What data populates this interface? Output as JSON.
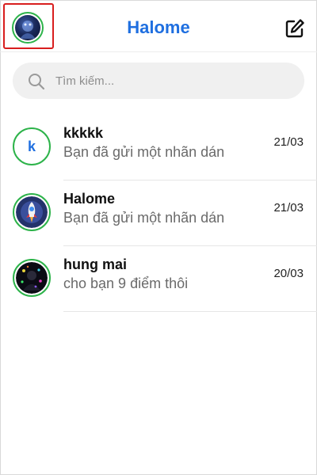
{
  "header": {
    "title": "Halome",
    "title_color": "#1f6fe0",
    "profile_icon": "profile-avatar-icon",
    "compose_icon": "compose-edit-icon",
    "highlight_color": "#d81e1e"
  },
  "search": {
    "placeholder": "Tìm kiếm...",
    "value": "",
    "icon": "search-icon"
  },
  "conversations": [
    {
      "name": "kkkkk",
      "avatar_letter": "k",
      "preview": "Bạn đã gửi một nhãn dán",
      "date": "21/03"
    },
    {
      "name": "Halome",
      "avatar_icon": "rocket-icon",
      "preview": "Bạn đã gửi một nhãn dán",
      "date": "21/03"
    },
    {
      "name": "hung mai",
      "avatar_icon": "photo-avatar",
      "preview": "cho bạn 9 điểm thôi",
      "date": "20/03"
    }
  ],
  "colors": {
    "online_ring": "#2db34a",
    "accent": "#1f6fe0"
  }
}
